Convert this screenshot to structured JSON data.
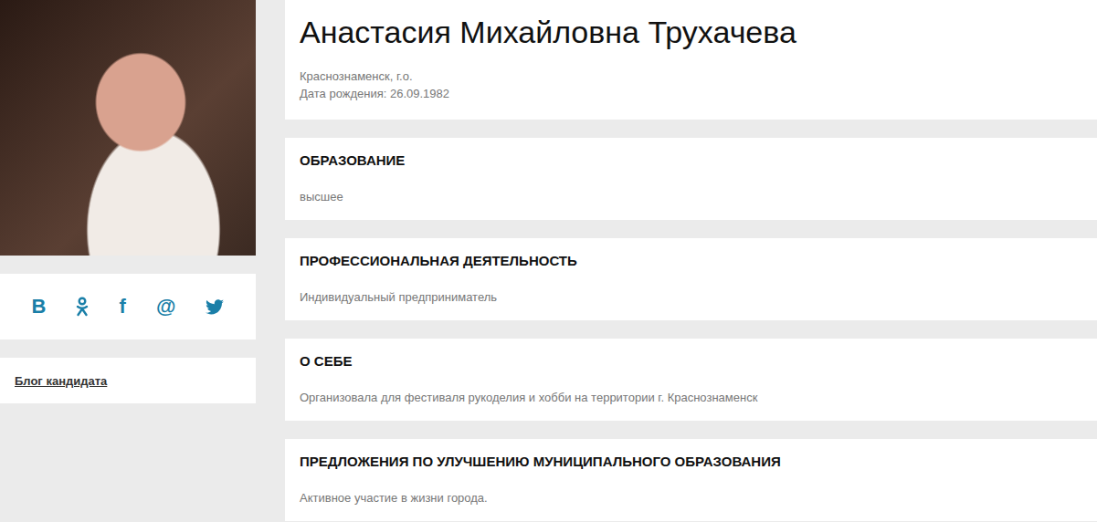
{
  "profile": {
    "name": "Анастасия Михайловна Трухачева",
    "location": "Краснознаменск, г.о.",
    "birth_date": "Дата рождения: 26.09.1982"
  },
  "social": [
    {
      "kind": "text",
      "label": "В"
    },
    {
      "kind": "ok"
    },
    {
      "kind": "text",
      "label": "f"
    },
    {
      "kind": "text",
      "label": "@"
    },
    {
      "kind": "twitter"
    }
  ],
  "blog_link": "Блог кандидата",
  "sections": [
    {
      "title": "ОБРАЗОВАНИЕ",
      "text": "высшее"
    },
    {
      "title": "ПРОФЕССИОНАЛЬНАЯ ДЕЯТЕЛЬНОСТЬ",
      "text": "Индивидуальный предприниматель"
    },
    {
      "title": "О СЕБЕ",
      "text": "Организовала для фестиваля рукоделия и хобби на территории г. Краснознаменск"
    },
    {
      "title": "ПРЕДЛОЖЕНИЯ ПО УЛУЧШЕНИЮ МУНИЦИПАЛЬНОГО ОБРАЗОВАНИЯ",
      "text": "Активное участие в жизни города."
    }
  ]
}
